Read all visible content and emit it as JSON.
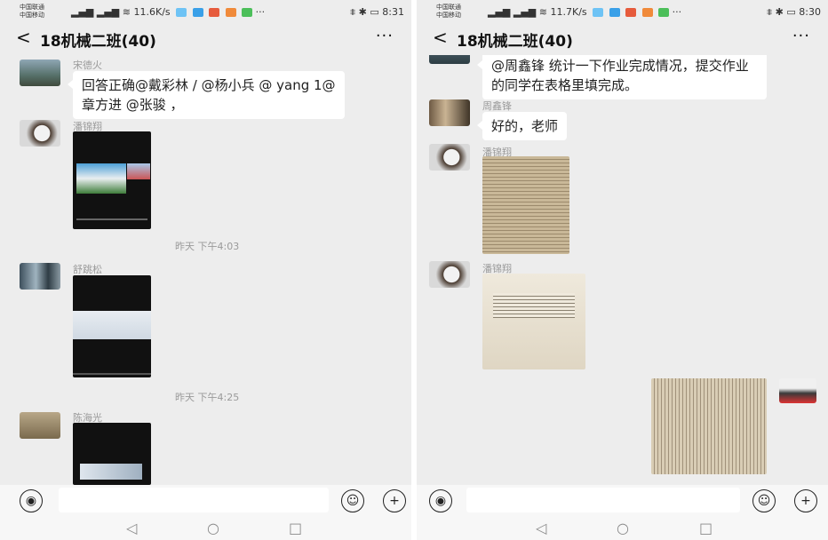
{
  "left": {
    "status": {
      "carrier1": "中国联通",
      "carrier2": "中国移动",
      "speed": "11.6K/s",
      "time": "8:31"
    },
    "header": {
      "back": "<",
      "title": "18机械二班(40)",
      "more": "···"
    },
    "messages": [
      {
        "sender": "宋德火",
        "text": "回答正确@戴彩林  / @杨小兵  @ yang 1@章方进 @张骏 ，"
      },
      {
        "sender": "潘锦翔",
        "type": "video"
      },
      {
        "time": "昨天 下午4:03"
      },
      {
        "sender": "舒跳松",
        "type": "video"
      },
      {
        "time": "昨天 下午4:25"
      },
      {
        "sender": "陈海光",
        "type": "video"
      }
    ]
  },
  "right": {
    "status": {
      "carrier1": "中国联通",
      "carrier2": "中国移动",
      "speed": "11.7K/s",
      "time": "8:30"
    },
    "header": {
      "back": "<",
      "title": "18机械二班(40)",
      "more": "···"
    },
    "messages": [
      {
        "text": "@周鑫锋  统计一下作业完成情况，提交作业的同学在表格里填完成。"
      },
      {
        "sender": "周鑫锋",
        "text": "好的，老师"
      },
      {
        "sender": "潘锦翔",
        "type": "photo"
      },
      {
        "sender": "潘锦翔",
        "type": "photo"
      },
      {
        "type": "photo",
        "self": true
      }
    ]
  },
  "icons": {
    "voice": "voice-icon",
    "emoji": "emoji-icon",
    "plus": "plus-icon",
    "nav_back": "◁",
    "nav_home": "○",
    "nav_recent": "□"
  },
  "colors": {
    "background": "#ededed",
    "bubble": "#ffffff",
    "meta_text": "#9a9a9a"
  }
}
